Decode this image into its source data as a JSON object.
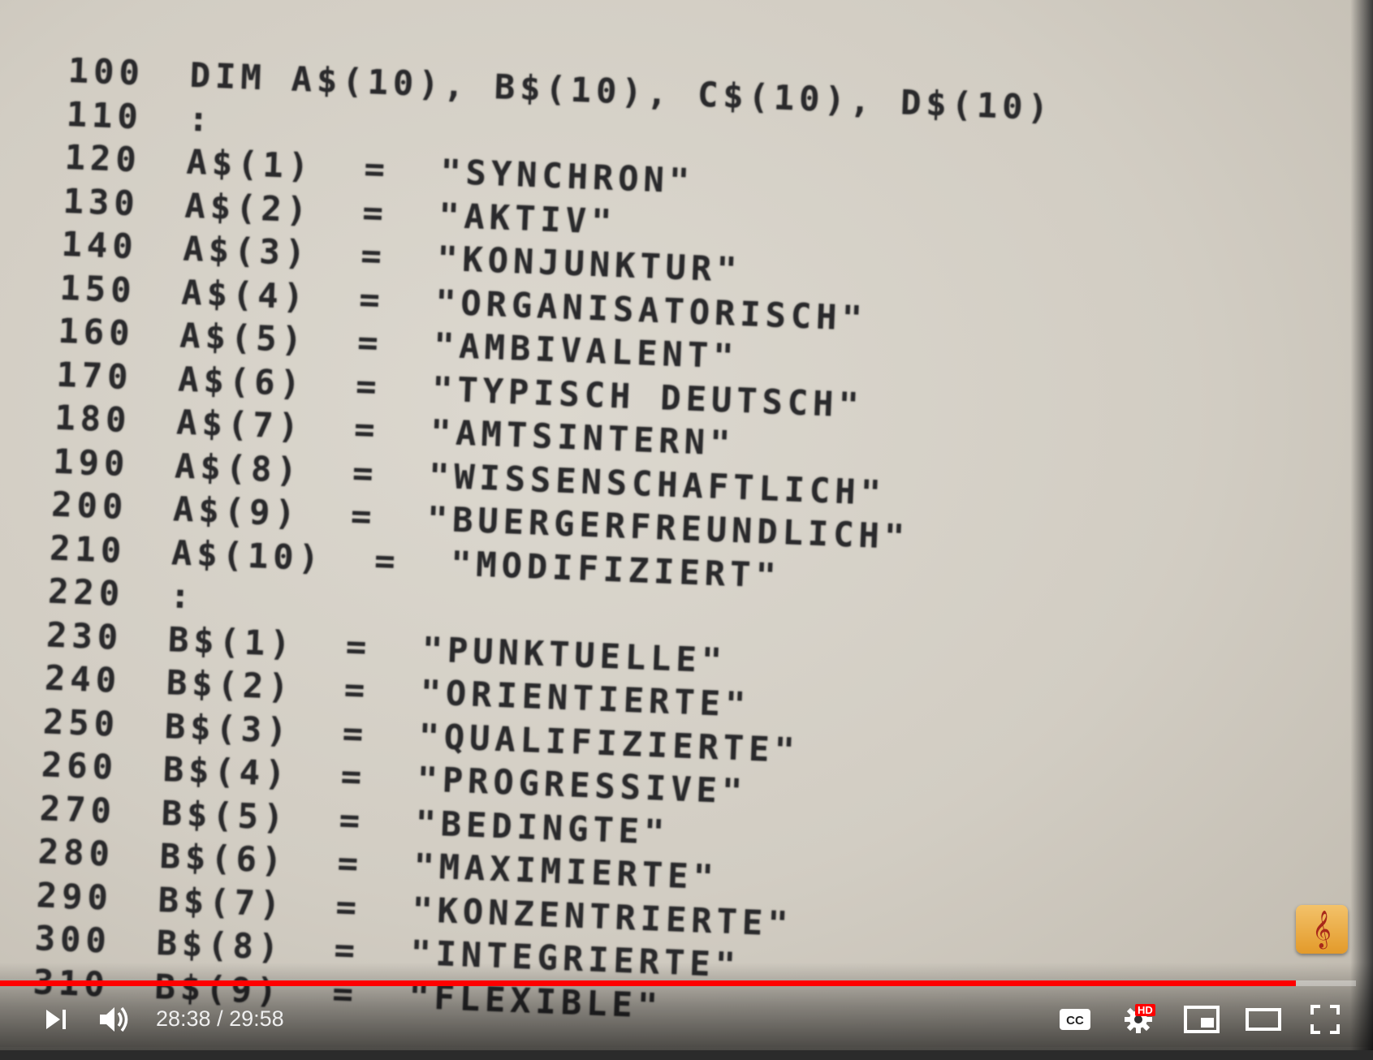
{
  "listing": [
    {
      "num": "100",
      "stmt": "DIM A$(10), B$(10), C$(10), D$(10)"
    },
    {
      "num": "110",
      "stmt": ":"
    },
    {
      "num": "120",
      "stmt": "A$(1)  =  \"SYNCHRON\""
    },
    {
      "num": "130",
      "stmt": "A$(2)  =  \"AKTIV\""
    },
    {
      "num": "140",
      "stmt": "A$(3)  =  \"KONJUNKTUR\""
    },
    {
      "num": "150",
      "stmt": "A$(4)  =  \"ORGANISATORISCH\""
    },
    {
      "num": "160",
      "stmt": "A$(5)  =  \"AMBIVALENT\""
    },
    {
      "num": "170",
      "stmt": "A$(6)  =  \"TYPISCH DEUTSCH\""
    },
    {
      "num": "180",
      "stmt": "A$(7)  =  \"AMTSINTERN\""
    },
    {
      "num": "190",
      "stmt": "A$(8)  =  \"WISSENSCHAFTLICH\""
    },
    {
      "num": "200",
      "stmt": "A$(9)  =  \"BUERGERFREUNDLICH\""
    },
    {
      "num": "210",
      "stmt": "A$(10)  =  \"MODIFIZIERT\""
    },
    {
      "num": "220",
      "stmt": ":"
    },
    {
      "num": "230",
      "stmt": "B$(1)  =  \"PUNKTUELLE\""
    },
    {
      "num": "240",
      "stmt": "B$(2)  =  \"ORIENTIERTE\""
    },
    {
      "num": "250",
      "stmt": "B$(3)  =  \"QUALIFIZIERTE\""
    },
    {
      "num": "260",
      "stmt": "B$(4)  =  \"PROGRESSIVE\""
    },
    {
      "num": "270",
      "stmt": "B$(5)  =  \"BEDINGTE\""
    },
    {
      "num": "280",
      "stmt": "B$(6)  =  \"MAXIMIERTE\""
    },
    {
      "num": "290",
      "stmt": "B$(7)  =  \"KONZENTRIERTE\""
    },
    {
      "num": "300",
      "stmt": "B$(8)  =  \"INTEGRIERTE\""
    },
    {
      "num": "310",
      "stmt": "B$(9)  =  \"FLEXIBLE\""
    }
  ],
  "player": {
    "current_time": "28:38",
    "duration": "29:58",
    "time_display": "28:38 / 29:58",
    "progress": 0.9555,
    "hd_badge": "HD",
    "progress_color": "#ff0000"
  },
  "controls": {
    "next_icon": "skip-next-icon",
    "volume_icon": "volume-icon",
    "cc_icon": "closed-captions-icon",
    "settings_icon": "gear-icon",
    "miniplayer_icon": "miniplayer-icon",
    "theater_icon": "theater-mode-icon",
    "fullscreen_icon": "fullscreen-icon",
    "channel_icon": "music-clef-icon"
  }
}
